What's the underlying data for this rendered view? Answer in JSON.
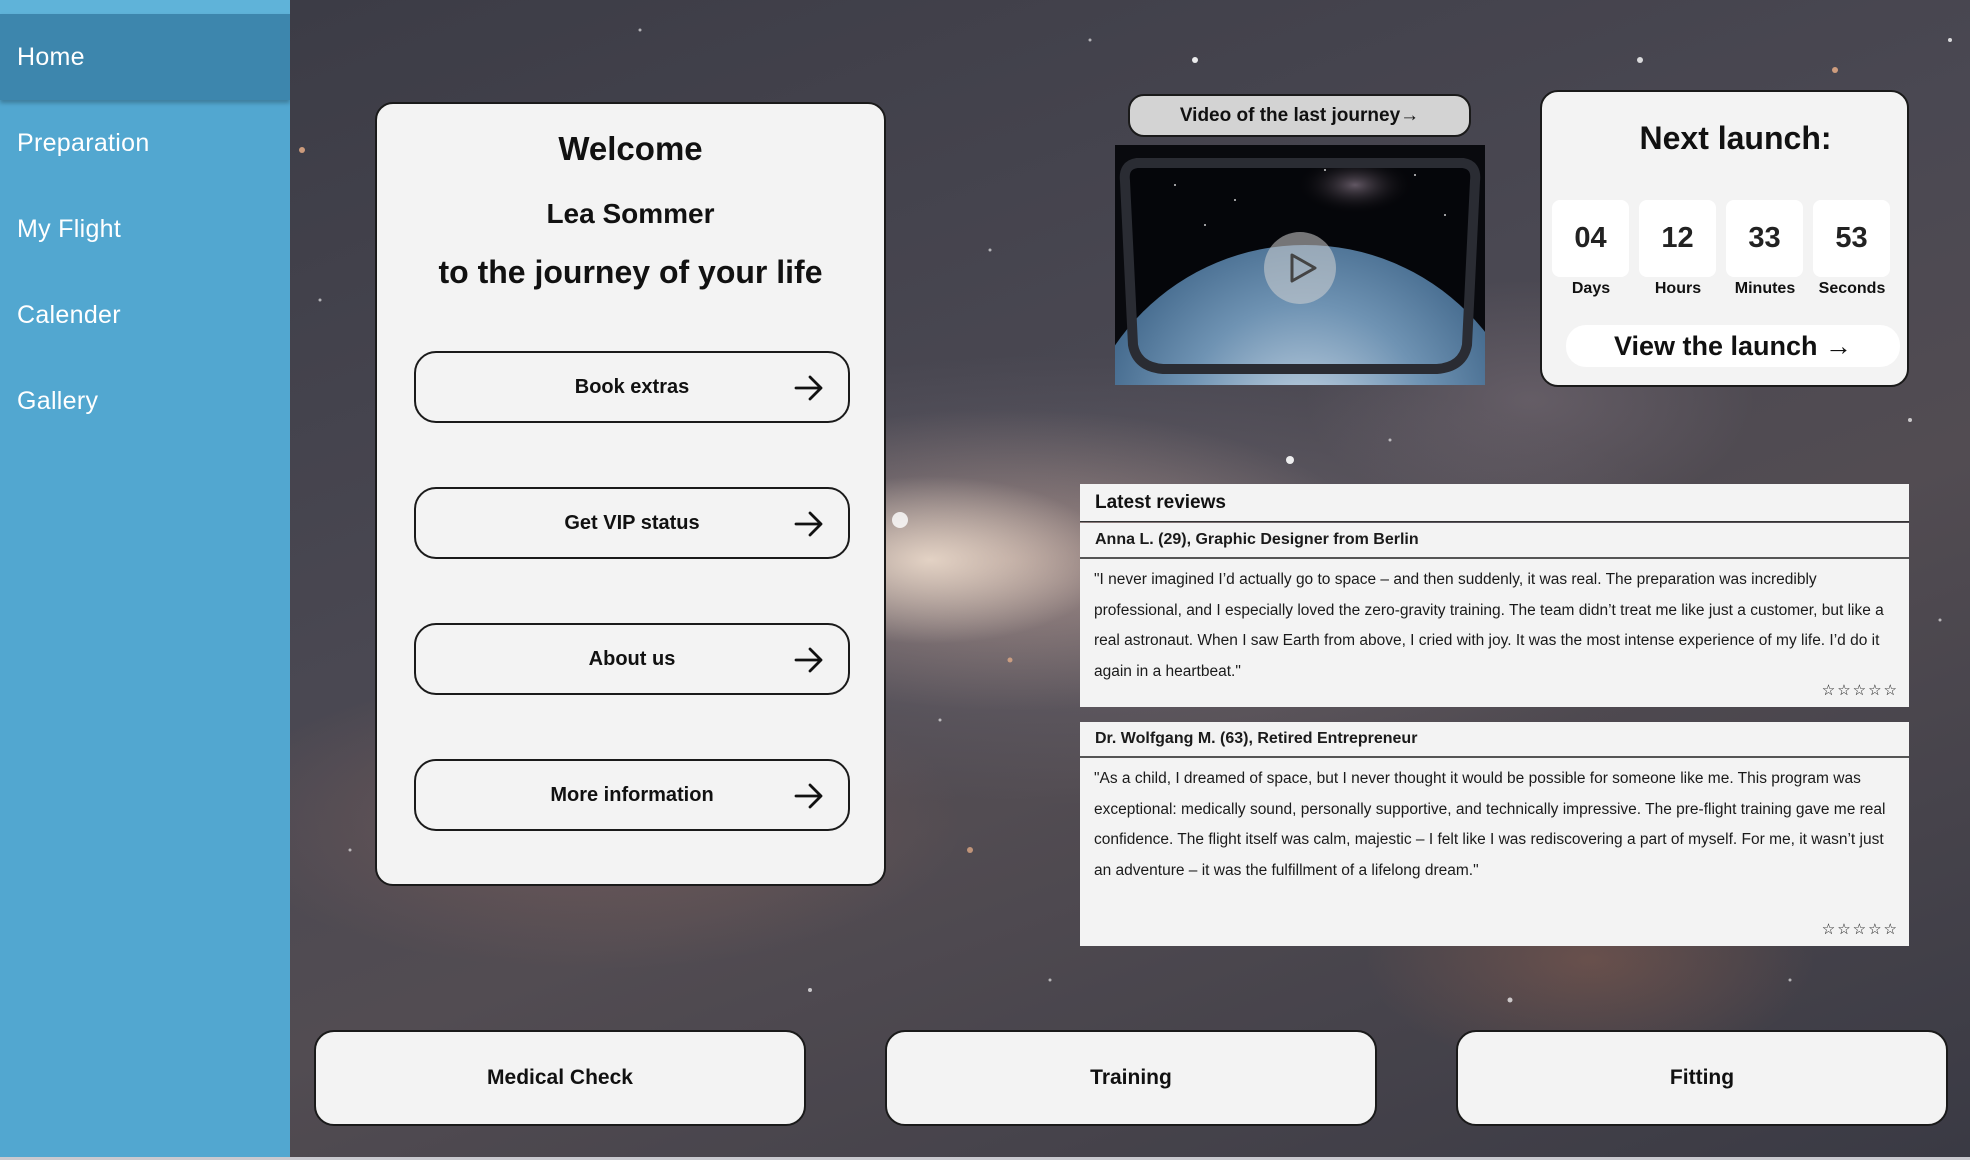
{
  "sidebar": {
    "items": [
      {
        "label": "Home",
        "active": true
      },
      {
        "label": "Preparation"
      },
      {
        "label": "My Flight"
      },
      {
        "label": "Calender"
      },
      {
        "label": "Gallery"
      }
    ],
    "color": "#52a7d0",
    "active_color": "#3d86ad"
  },
  "welcome": {
    "title": "Welcome",
    "name": "Lea Sommer",
    "subtitle": "to the journey of your life",
    "buttons": [
      {
        "label": "Book extras",
        "icon": "arrow-right-icon"
      },
      {
        "label": "Get VIP status",
        "icon": "arrow-right-icon"
      },
      {
        "label": "About us",
        "icon": "arrow-right-icon"
      },
      {
        "label": "More information",
        "icon": "arrow-right-icon"
      }
    ]
  },
  "video": {
    "label": "Video of the last journey→",
    "icon": "play-icon"
  },
  "countdown": {
    "title": "Next launch:",
    "units": [
      {
        "value": "04",
        "label": "Days"
      },
      {
        "value": "12",
        "label": "Hours"
      },
      {
        "value": "33",
        "label": "Minutes"
      },
      {
        "value": "53",
        "label": "Seconds"
      }
    ],
    "button_label": "View the launch →"
  },
  "reviews": {
    "heading": "Latest reviews",
    "items": [
      {
        "author": "Anna L. (29), Graphic Designer from Berlin",
        "text": "\"I never imagined I’d actually go to space – and then suddenly, it was real. The preparation was incredibly professional, and I especially loved the zero-gravity training. The team didn’t treat me like just a customer, but like a real astronaut. When I saw Earth from above, I cried with joy. It was the most intense experience of my life. I’d do it again in a heartbeat.\"",
        "stars": "☆☆☆☆☆"
      },
      {
        "author": "Dr. Wolfgang M. (63), Retired Entrepreneur",
        "text": "\"As a child, I dreamed of space, but I never thought it would be possible for someone like me. This program was exceptional: medically sound, personally supportive, and technically impressive. The pre-flight training gave me real confidence. The flight itself was calm, majestic – I felt like I was rediscovering a part of myself. For me, it wasn’t just an adventure – it was the fulfillment of a lifelong dream.\"",
        "stars": "☆☆☆☆☆"
      }
    ]
  },
  "bottom": {
    "buttons": [
      {
        "label": "Medical Check"
      },
      {
        "label": "Training"
      },
      {
        "label": "Fitting"
      }
    ]
  }
}
